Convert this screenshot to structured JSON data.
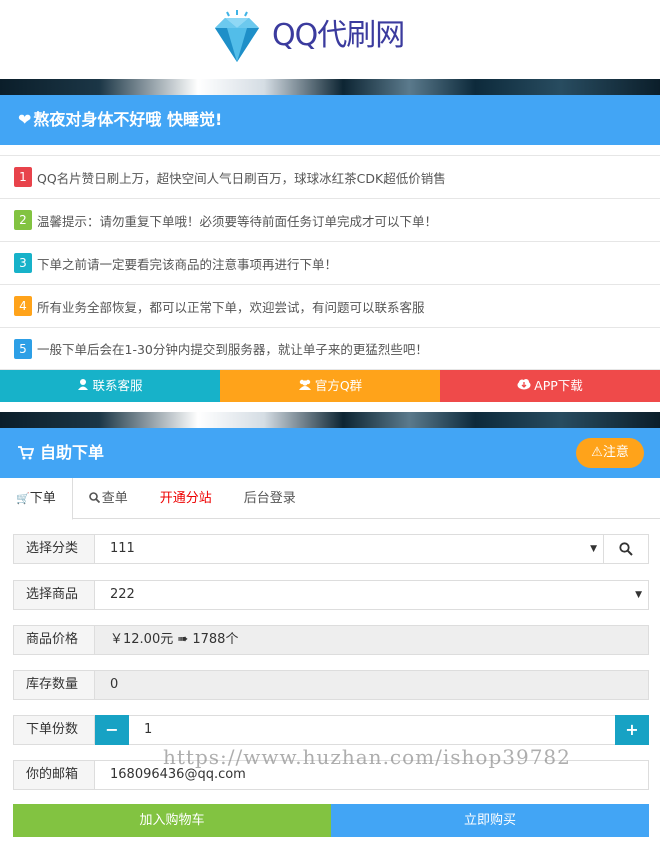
{
  "logo": {
    "text": "QQ代刷网",
    "icon": "diamond-icon"
  },
  "notice": {
    "title": "熬夜对身体不好哦 快睡觉!",
    "items": [
      {
        "num": "1",
        "color": "#e8434b",
        "text": "QQ名片赞日刷上万，超快空间人气日刷百万，球球冰红茶CDK超低价销售"
      },
      {
        "num": "2",
        "color": "#82c341",
        "text": "温馨提示：请勿重复下单哦！必须要等待前面任务订单完成才可以下单！"
      },
      {
        "num": "3",
        "color": "#17b2c9",
        "text": "下单之前请一定要看完该商品的注意事项再进行下单！"
      },
      {
        "num": "4",
        "color": "#ffa31a",
        "text": "所有业务全部恢复，都可以正常下单，欢迎尝试，有问题可以联系客服"
      },
      {
        "num": "5",
        "color": "#2d9fe6",
        "text": "一般下单后会在1-30分钟内提交到服务器，就让单子来的更猛烈些吧！"
      }
    ]
  },
  "action_buttons": [
    {
      "label": "联系客服",
      "color": "#17b2c9",
      "icon": "user-icon"
    },
    {
      "label": "官方Q群",
      "color": "#ffa31a",
      "icon": "group-icon"
    },
    {
      "label": "APP下载",
      "color": "#ef4a4a",
      "icon": "cloud-download-icon"
    }
  ],
  "order": {
    "title": "自助下单",
    "attention_label": "注意",
    "tabs": [
      {
        "label": "下单",
        "active": true
      },
      {
        "label": "查单"
      },
      {
        "label": "开通分站"
      },
      {
        "label": "后台登录"
      }
    ],
    "category": {
      "label": "选择分类",
      "value": "111"
    },
    "product": {
      "label": "选择商品",
      "value": "222"
    },
    "price": {
      "label": "商品价格",
      "value": "￥12.00元 ➠ 1788个"
    },
    "stock": {
      "label": "库存数量",
      "value": "0"
    },
    "quantity": {
      "label": "下单份数",
      "value": "1",
      "minus": "−",
      "plus": "+"
    },
    "email": {
      "label": "你的邮箱",
      "value": "168096436@qq.com"
    },
    "add_cart_label": "加入购物车",
    "buy_now_label": "立即购买"
  },
  "watermark": "https://www.huzhan.com/ishop39782",
  "colors": {
    "primary": "#42a5f5",
    "green": "#82c341",
    "blue_btn": "#42a5f5",
    "teal": "#17a2c4"
  }
}
